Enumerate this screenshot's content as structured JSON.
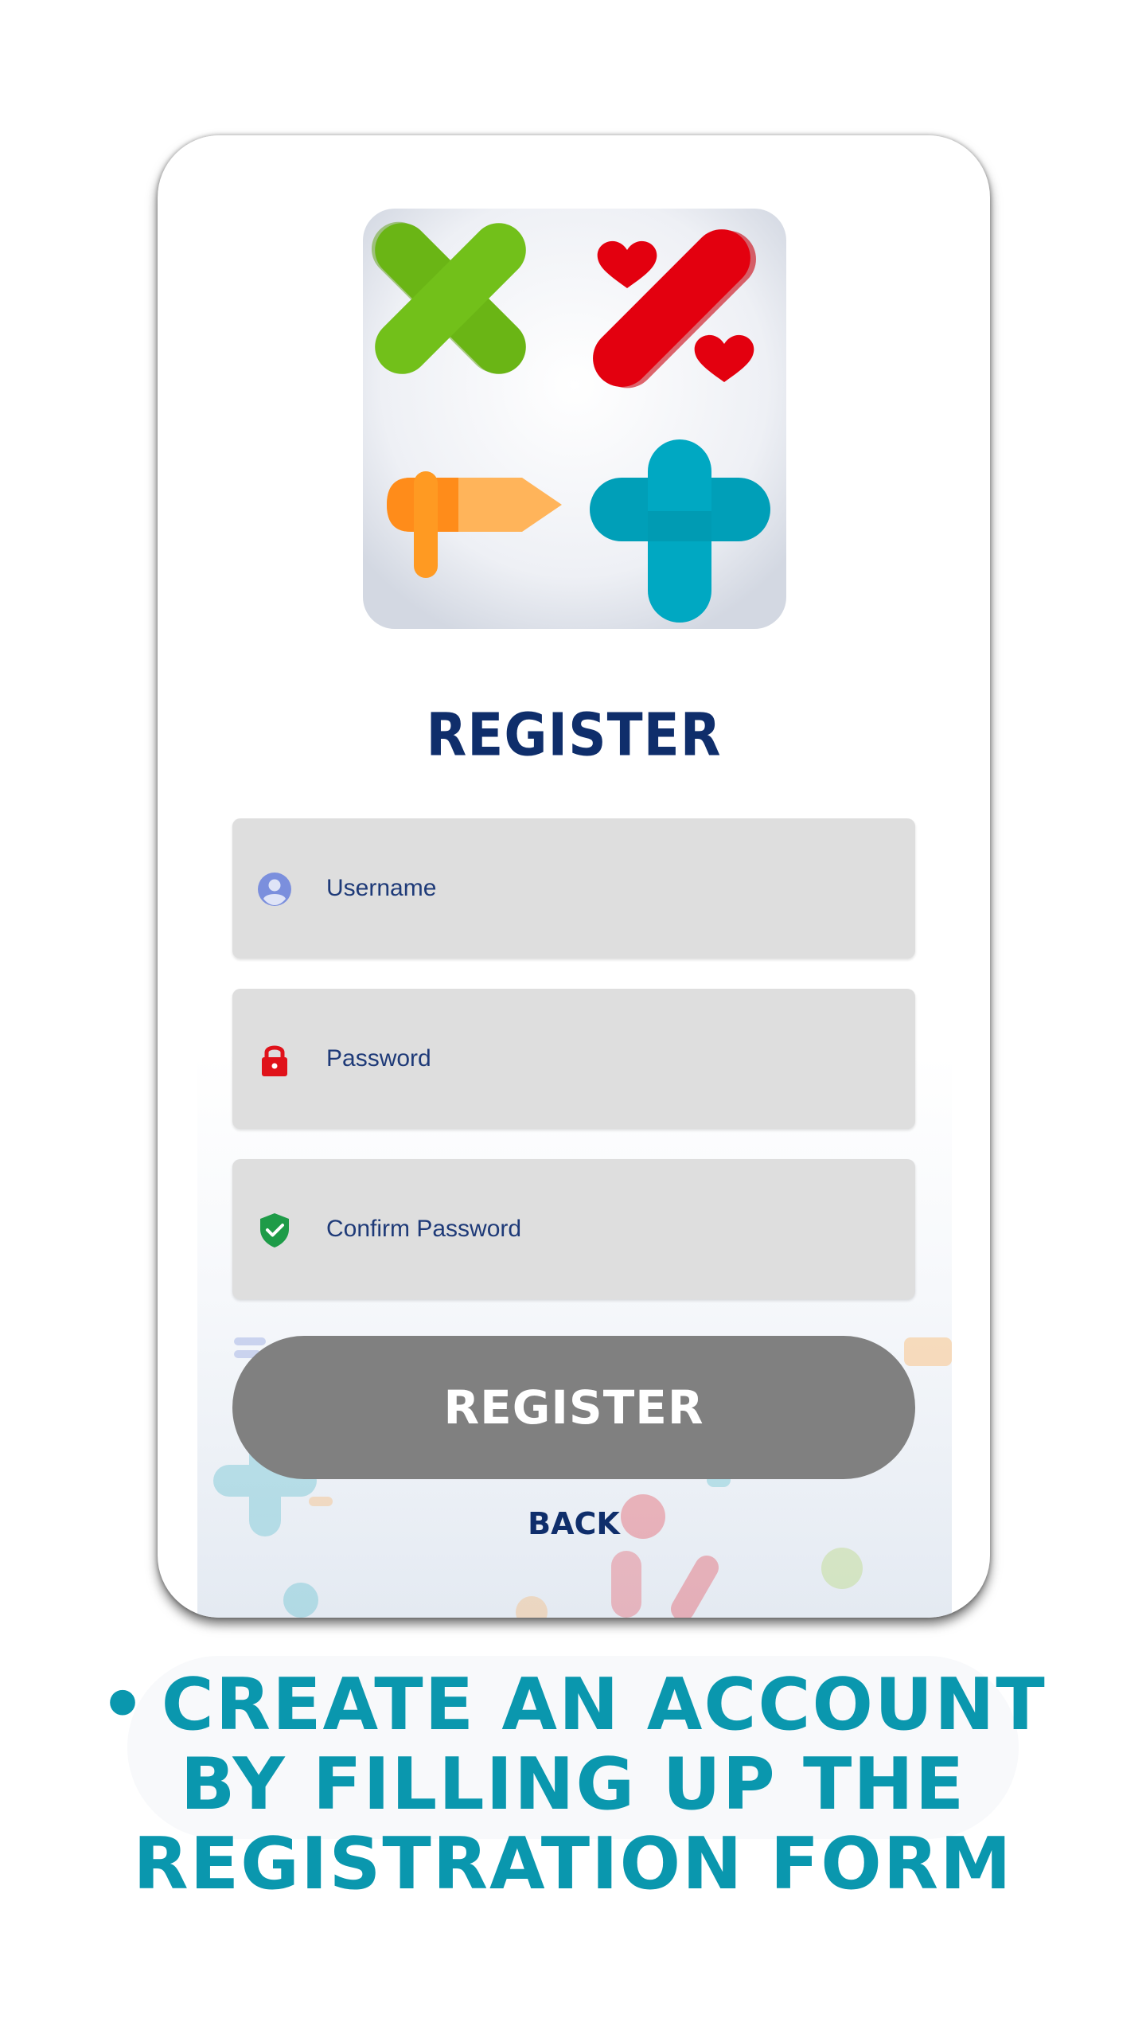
{
  "form": {
    "title": "REGISTER",
    "fields": [
      {
        "placeholder": "Username",
        "icon": "user-icon",
        "icon_color": "#6f86d6"
      },
      {
        "placeholder": "Password",
        "icon": "lock-icon",
        "icon_color": "#e0121a"
      },
      {
        "placeholder": "Confirm Password",
        "icon": "shield-check-icon",
        "icon_color": "#1e9b48"
      }
    ],
    "register_button": "REGISTER",
    "back_link": "BACK"
  },
  "logo": {
    "icons": [
      "multiply-icon",
      "percent-icon",
      "minus-icon",
      "plus-icon"
    ],
    "colors": {
      "multiply": "#6ab515",
      "percent": "#e3000f",
      "minus": "#ff8c1a",
      "plus": "#009fb8"
    }
  },
  "caption": {
    "bullet": "•",
    "text": "Create an account by filling up the registration form"
  },
  "colors": {
    "title": "#0f2e6b",
    "field_bg": "#dedede",
    "button_bg": "#808080",
    "caption": "#0a97ae"
  }
}
